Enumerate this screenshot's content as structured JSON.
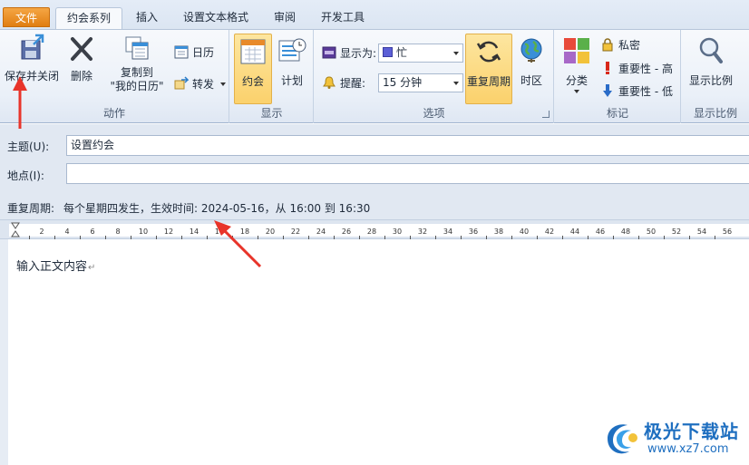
{
  "tabs": {
    "file": "文件",
    "appointment_series": "约会系列",
    "insert": "插入",
    "format_text": "设置文本格式",
    "review": "审阅",
    "developer": "开发工具"
  },
  "ribbon": {
    "actions": {
      "save_close": "保存并关闭",
      "delete": "删除",
      "copy_to_line1": "复制到",
      "copy_to_line2": "\"我的日历\"",
      "calendar": "日历",
      "forward": "转发",
      "group_label": "动作"
    },
    "show": {
      "appointment": "约会",
      "scheduling": "计划",
      "group_label": "显示"
    },
    "options": {
      "show_as_label": "显示为:",
      "show_as_value": "忙",
      "reminder_label": "提醒:",
      "reminder_value": "15 分钟",
      "recurrence": "重复周期",
      "time_zones": "时区",
      "group_label": "选项"
    },
    "tags": {
      "categorize": "分类",
      "private": "私密",
      "high_importance": "重要性 - 高",
      "low_importance": "重要性 - 低",
      "group_label": "标记"
    },
    "zoom": {
      "zoom": "显示比例",
      "group_label": "显示比例"
    }
  },
  "form": {
    "subject_label": "主题(U):",
    "subject_value": "设置约会",
    "location_label": "地点(I):",
    "location_value": "",
    "recurrence_label": "重复周期:",
    "recurrence_value": "每个星期四发生，生效时间: 2024-05-16，从 16:00 到 16:30"
  },
  "ruler": {
    "ticks": [
      "2",
      "4",
      "6",
      "8",
      "10",
      "12",
      "14",
      "16",
      "18",
      "20",
      "22",
      "24",
      "26",
      "28",
      "30",
      "32",
      "34",
      "36",
      "38",
      "40",
      "42",
      "44",
      "46",
      "48",
      "50",
      "52",
      "54",
      "56"
    ]
  },
  "body": {
    "text": "输入正文内容"
  },
  "watermark": {
    "title": "极光下载站",
    "url": "www.xz7.com"
  },
  "colors": {
    "file_tab": "#e8861c",
    "selected_button": "#fbd16c",
    "annotation_arrow": "#e8342a",
    "watermark": "#1f6fc0"
  }
}
